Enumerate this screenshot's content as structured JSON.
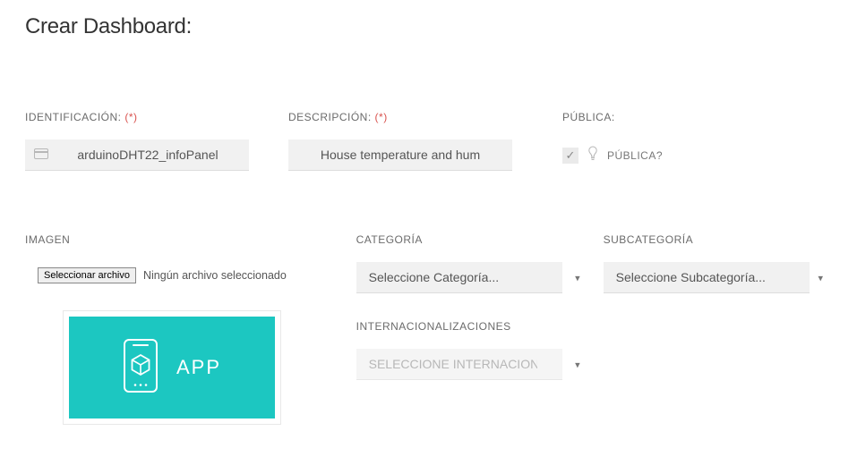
{
  "page": {
    "title": "Crear Dashboard:"
  },
  "fields": {
    "ident": {
      "label": "IDENTIFICACIÓN:",
      "required": "(*)",
      "value": "arduinoDHT22_infoPanel"
    },
    "desc": {
      "label": "DESCRIPCIÓN:",
      "required": "(*)",
      "value": "House temperature and hum"
    },
    "publica": {
      "label": "PÚBLICA:",
      "checkbox_label": "PÚBLICA?",
      "checked": true
    },
    "imagen": {
      "label": "IMAGEN",
      "button": "Seleccionar archivo",
      "status": "Ningún archivo seleccionado",
      "preview_text": "APP"
    },
    "categoria": {
      "label": "CATEGORÍA",
      "placeholder": "Seleccione Categoría..."
    },
    "subcategoria": {
      "label": "SUBCATEGORÍA",
      "placeholder": "Seleccione Subcategoría..."
    },
    "intl": {
      "label": "INTERNACIONALIZACIONES",
      "placeholder": "SELECCIONE INTERNACIONALIZACION"
    }
  }
}
